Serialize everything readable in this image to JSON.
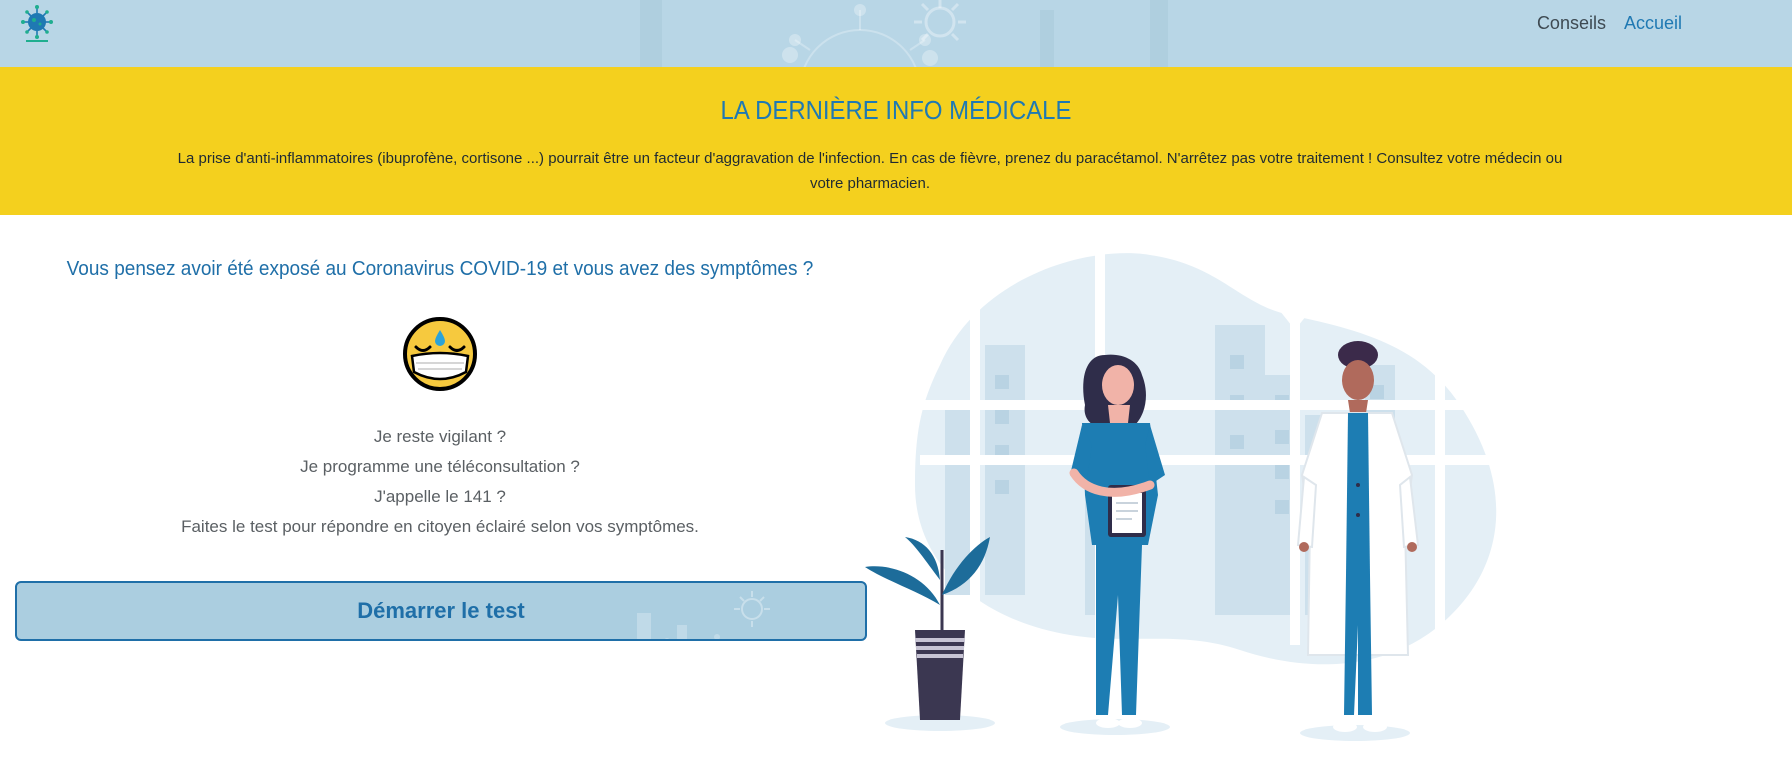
{
  "header": {
    "logo_icon": "virus-logo-icon",
    "nav": {
      "conseils": "Conseils",
      "accueil": "Accueil"
    },
    "colors": {
      "background": "#b8d6e6",
      "accent": "#1f79b3"
    }
  },
  "banner": {
    "title": "LA DERNIÈRE INFO MÉDICALE",
    "text": "La prise d'anti-inflammatoires (ibuprofène, cortisone ...) pourrait être un facteur d'aggravation de l'infection. En cas de fièvre, prenez du paracétamol. N'arrêtez pas votre traitement ! Consultez votre médecin ou votre pharmacien.",
    "color": "#f4d01e"
  },
  "main": {
    "question": "Vous pensez avoir été exposé au Coronavirus COVID-19 et vous avez des symptômes ?",
    "emoji_icon": "masked-face-sweat-icon",
    "lines": [
      "Je reste vigilant ?",
      "Je programme une téléconsultation ?",
      "J'appelle le 141 ?",
      "Faites le test pour répondre en citoyen éclairé selon vos symptômes."
    ],
    "start_button": "Démarrer le test"
  },
  "illustration": {
    "icon": "doctors-illustration-icon"
  }
}
